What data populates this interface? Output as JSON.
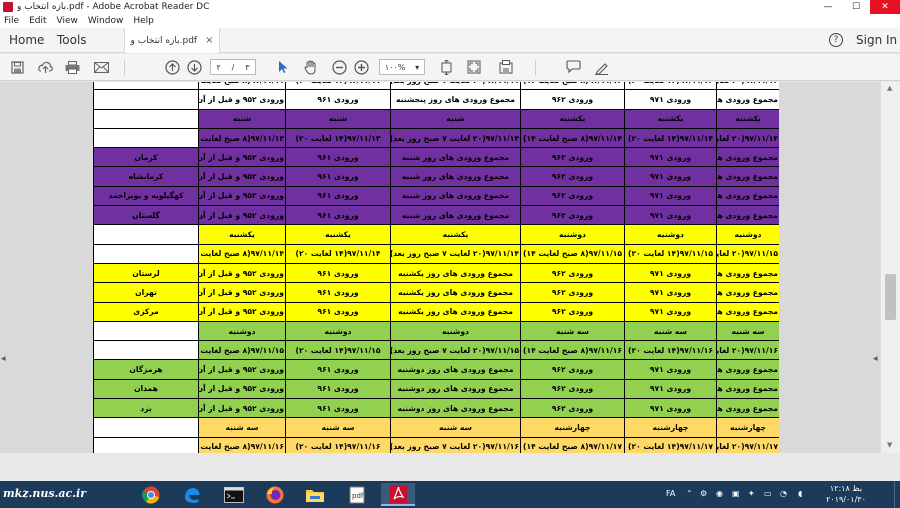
{
  "window": {
    "title": "بازه انتخاب و.pdf - Adobe Acrobat Reader DC",
    "minimize": "—",
    "maximize": "☐",
    "close": "✕"
  },
  "menu": [
    "File",
    "Edit",
    "View",
    "Window",
    "Help"
  ],
  "nav": {
    "home": "Home",
    "tools": "Tools",
    "doc_tab": "بازه انتخاب و.pdf",
    "doc_tab_close": "×",
    "sign_in": "Sign In",
    "help": "?"
  },
  "toolbar": {
    "page_current": "۲",
    "page_sep": "/",
    "page_total": "۳",
    "zoom": "۱۰۰%",
    "icons": [
      "save-icon",
      "upload-icon",
      "print-icon",
      "email-icon",
      "prev-page-icon",
      "next-page-icon",
      "select-cursor-icon",
      "hand-icon",
      "zoom-out-icon",
      "zoom-in-icon",
      "fit-page-icon",
      "full-screen-icon",
      "rotate-icon",
      "comment-icon",
      "sign-pen-icon"
    ]
  },
  "table": {
    "rows": [
      {
        "cls": "w",
        "cells": [
          "۹۷/۱۱/۱۲(۲۰ لغایت ۷ صبح روز بعد)",
          "۹۷/۱۱/۱۲(۱۴ لغایت ۲۰)",
          "۹۷/۱۱/۱۲(۸ صبح لغایت ۱۴)",
          "۹۷/۱۱/۱۱(۲۰ لغایت ۷ صبح روز بعد)",
          "۹۷/۱۱/۱۱(۱۴ لغایت ۲۰)",
          "۹۷/۱۱/۱۱(۸ صبح لغایت ۱۴)",
          ""
        ]
      },
      {
        "cls": "w",
        "cells": [
          "مجموع ورودی های روز جمعه",
          "ورودی ۹۷۱",
          "ورودی ۹۶۲",
          "مجموع ورودی های روز پنجشنبه",
          "ورودی ۹۶۱",
          "ورودی ۹۵۲ و قبل از آن",
          ""
        ]
      },
      {
        "cls": "p",
        "cells": [
          "یکشنبه",
          "یکشنبه",
          "یکشنبه",
          "شنبه",
          "شنبه",
          "شنبه",
          ""
        ]
      },
      {
        "cls": "p",
        "cells": [
          "۹۷/۱۱/۱۴(۲۰ لغایت ۷ صبح روز بعد)",
          "۹۷/۱۱/۱۴(۱۴ لغایت ۲۰)",
          "۹۷/۱۱/۱۴(۸ صبح لغایت ۱۴)",
          "۹۷/۱۱/۱۳(۲۰ لغایت ۷ صبح روز بعد)",
          "۹۷/۱۱/۱۳(۱۴ لغایت ۲۰)",
          "۹۷/۱۱/۱۳(۸ صبح لغایت ۱۴)",
          ""
        ]
      },
      {
        "cls": "p",
        "cells": [
          "مجموع ورودی های روز یکشنبه",
          "ورودی ۹۷۱",
          "ورودی ۹۶۲",
          "مجموع ورودی های روز شنبه",
          "ورودی ۹۶۱",
          "ورودی ۹۵۲ و قبل از آن",
          "کرمان"
        ]
      },
      {
        "cls": "p",
        "cells": [
          "مجموع ورودی های روز یکشنبه",
          "ورودی ۹۷۱",
          "ورودی ۹۶۲",
          "مجموع ورودی های روز شنبه",
          "ورودی ۹۶۱",
          "ورودی ۹۵۲ و قبل از آن",
          "کرمانشاه"
        ]
      },
      {
        "cls": "p",
        "cells": [
          "مجموع ورودی های روز یکشنبه",
          "ورودی ۹۷۱",
          "ورودی ۹۶۲",
          "مجموع ورودی های روز شنبه",
          "ورودی ۹۶۱",
          "ورودی ۹۵۲ و قبل از آن",
          "کهگیلویه و بویراحمد"
        ]
      },
      {
        "cls": "p",
        "cells": [
          "مجموع ورودی های روز یکشنبه",
          "ورودی ۹۷۱",
          "ورودی ۹۶۲",
          "مجموع ورودی های روز شنبه",
          "ورودی ۹۶۱",
          "ورودی ۹۵۲ و قبل از آن",
          "گلستان"
        ]
      },
      {
        "cls": "y",
        "cells": [
          "دوشنبه",
          "دوشنبه",
          "دوشنبه",
          "یکشنبه",
          "یکشنبه",
          "یکشنبه",
          ""
        ]
      },
      {
        "cls": "y",
        "cells": [
          "۹۷/۱۱/۱۵(۲۰ لغایت ۷ صبح روز بعد)",
          "۹۷/۱۱/۱۵(۱۴ لغایت ۲۰)",
          "۹۷/۱۱/۱۵(۸ صبح لغایت ۱۴)",
          "۹۷/۱۱/۱۴(۲۰ لغایت ۷ صبح روز بعد)",
          "۹۷/۱۱/۱۴(۱۴ لغایت ۲۰)",
          "۹۷/۱۱/۱۴(۸ صبح لغایت ۱۴)",
          ""
        ]
      },
      {
        "cls": "y",
        "cells": [
          "مجموع ورودی های روز دوشنبه",
          "ورودی ۹۷۱",
          "ورودی ۹۶۲",
          "مجموع ورودی های روز یکشنبه",
          "ورودی ۹۶۱",
          "ورودی ۹۵۲ و قبل از آن",
          "لرستان"
        ]
      },
      {
        "cls": "y",
        "cells": [
          "مجموع ورودی های روز دوشنبه",
          "ورودی ۹۷۱",
          "ورودی ۹۶۲",
          "مجموع ورودی های روز یکشنبه",
          "ورودی ۹۶۱",
          "ورودی ۹۵۲ و قبل از آن",
          "تهران"
        ]
      },
      {
        "cls": "y",
        "cells": [
          "مجموع ورودی های روز دوشنبه",
          "ورودی ۹۷۱",
          "ورودی ۹۶۲",
          "مجموع ورودی های روز یکشنبه",
          "ورودی ۹۶۱",
          "ورودی ۹۵۲ و قبل از آن",
          "مرکزی"
        ]
      },
      {
        "cls": "g",
        "cells": [
          "سه شنبه",
          "سه شنبه",
          "سه شنبه",
          "دوشنبه",
          "دوشنبه",
          "دوشنبه",
          ""
        ]
      },
      {
        "cls": "g",
        "cells": [
          "۹۷/۱۱/۱۶(۲۰ لغایت ۷ صبح روز بعد)",
          "۹۷/۱۱/۱۶(۱۴ لغایت ۲۰)",
          "۹۷/۱۱/۱۶(۸ صبح لغایت ۱۴)",
          "۹۷/۱۱/۱۵(۲۰ لغایت ۷ صبح روز بعد)",
          "۹۷/۱۱/۱۵(۱۴ لغایت ۲۰)",
          "۹۷/۱۱/۱۵(۸ صبح لغایت ۱۴)",
          ""
        ]
      },
      {
        "cls": "g",
        "cells": [
          "مجموع ورودی های روز سه شنبه",
          "ورودی ۹۷۱",
          "ورودی ۹۶۲",
          "مجموع ورودی های روز دوشنبه",
          "ورودی ۹۶۱",
          "ورودی ۹۵۲ و قبل از آن",
          "هرمزگان"
        ]
      },
      {
        "cls": "g",
        "cells": [
          "مجموع ورودی های روز سه شنبه",
          "ورودی ۹۷۱",
          "ورودی ۹۶۲",
          "مجموع ورودی های روز دوشنبه",
          "ورودی ۹۶۱",
          "ورودی ۹۵۲ و قبل از آن",
          "همدان"
        ]
      },
      {
        "cls": "g",
        "cells": [
          "مجموع ورودی های روز سه شنبه",
          "ورودی ۹۷۱",
          "ورودی ۹۶۲",
          "مجموع ورودی های روز دوشنبه",
          "ورودی ۹۶۱",
          "ورودی ۹۵۲ و قبل از آن",
          "یزد"
        ]
      },
      {
        "cls": "o",
        "cells": [
          "چهارشنبه",
          "چهارشنبه",
          "چهارشنبه",
          "سه شنبه",
          "سه شنبه",
          "سه شنبه",
          ""
        ]
      },
      {
        "cls": "o",
        "cells": [
          "۹۷/۱۱/۱۷(۲۰ لغایت ۷ صبح روز بعد)",
          "۹۷/۱۱/۱۷(۱۴ لغایت ۲۰)",
          "۹۷/۱۱/۱۷(۸ صبح لغایت ۱۴)",
          "۹۷/۱۱/۱۶(۲۰ لغایت ۷ صبح روز بعد)",
          "۹۷/۱۱/۱۶(۱۴ لغایت ۲۰)",
          "۹۷/۱۱/۱۶(۸ صبح لغایت ۱۴)",
          ""
        ]
      }
    ]
  },
  "taskbar": {
    "watermark": "mkz.nus.ac.ir",
    "apps": [
      "chrome-icon",
      "edge-icon",
      "terminal-icon",
      "firefox-icon",
      "file-explorer-icon",
      "document-app-icon",
      "acrobat-icon"
    ],
    "lang": "FA",
    "clock_time": "بظ ۱۲:۱۸",
    "clock_date": "۲۰۱۹/۰۱/۳۰"
  },
  "colors": {
    "purple": "#7030a0",
    "yellow": "#ffff00",
    "green": "#92d050",
    "orange": "#ffd966"
  }
}
